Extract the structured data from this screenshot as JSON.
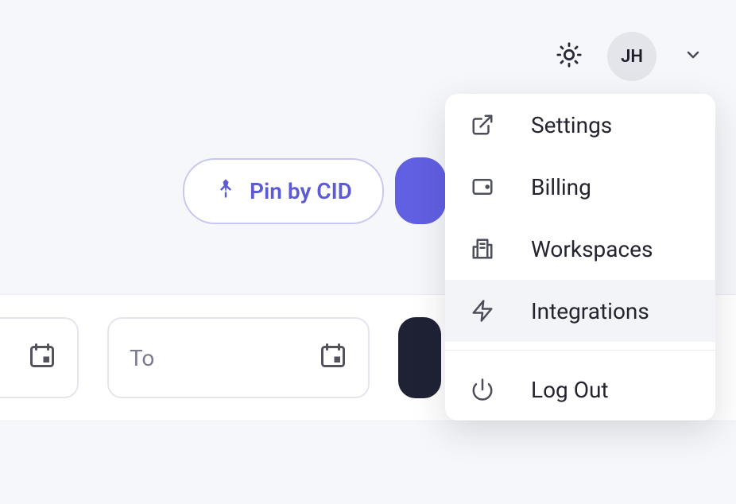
{
  "header": {
    "avatar_initials": "JH"
  },
  "toolbar": {
    "pin_label": "Pin by CID"
  },
  "filters": {
    "to_placeholder": "To"
  },
  "user_menu": {
    "items": [
      {
        "label": "Settings"
      },
      {
        "label": "Billing"
      },
      {
        "label": "Workspaces"
      },
      {
        "label": "Integrations"
      },
      {
        "label": "Log Out"
      }
    ]
  }
}
